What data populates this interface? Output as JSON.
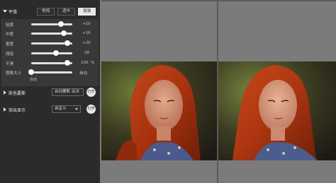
{
  "panel": {
    "section_title": "平滑",
    "modes": [
      {
        "label": "常规",
        "active": false
      },
      {
        "label": "适中",
        "active": false
      },
      {
        "label": "增强",
        "active": true
      }
    ],
    "sliders": [
      {
        "label": "轻度",
        "value": "+10",
        "fraction": 0.72
      },
      {
        "label": "中度",
        "value": "+16",
        "fraction": 0.8
      },
      {
        "label": "重度",
        "value": "+20",
        "fraction": 0.88
      },
      {
        "label": "阈值",
        "value": "28",
        "fraction": 0.6
      },
      {
        "label": "平滑",
        "value": "100",
        "unit": "%",
        "fraction": 0.88
      }
    ],
    "pattern": {
      "label": "图像大小",
      "value": "自动",
      "sub_label": "自动",
      "fraction": 0.0
    },
    "skin": {
      "title": "肤色要斯",
      "option_label": "自动要斯 关闭",
      "toggle_label": "打开"
    },
    "highlight": {
      "title": "突出显示",
      "option_label": "自定义",
      "toggle_label": "打开"
    }
  },
  "viewer": {
    "panes": [
      "before-image",
      "after-image"
    ]
  },
  "colors": {
    "panel_bg": "#2b2b2b",
    "viewer_bg": "#7b7b7b",
    "active_button": "#e8e8e8"
  }
}
